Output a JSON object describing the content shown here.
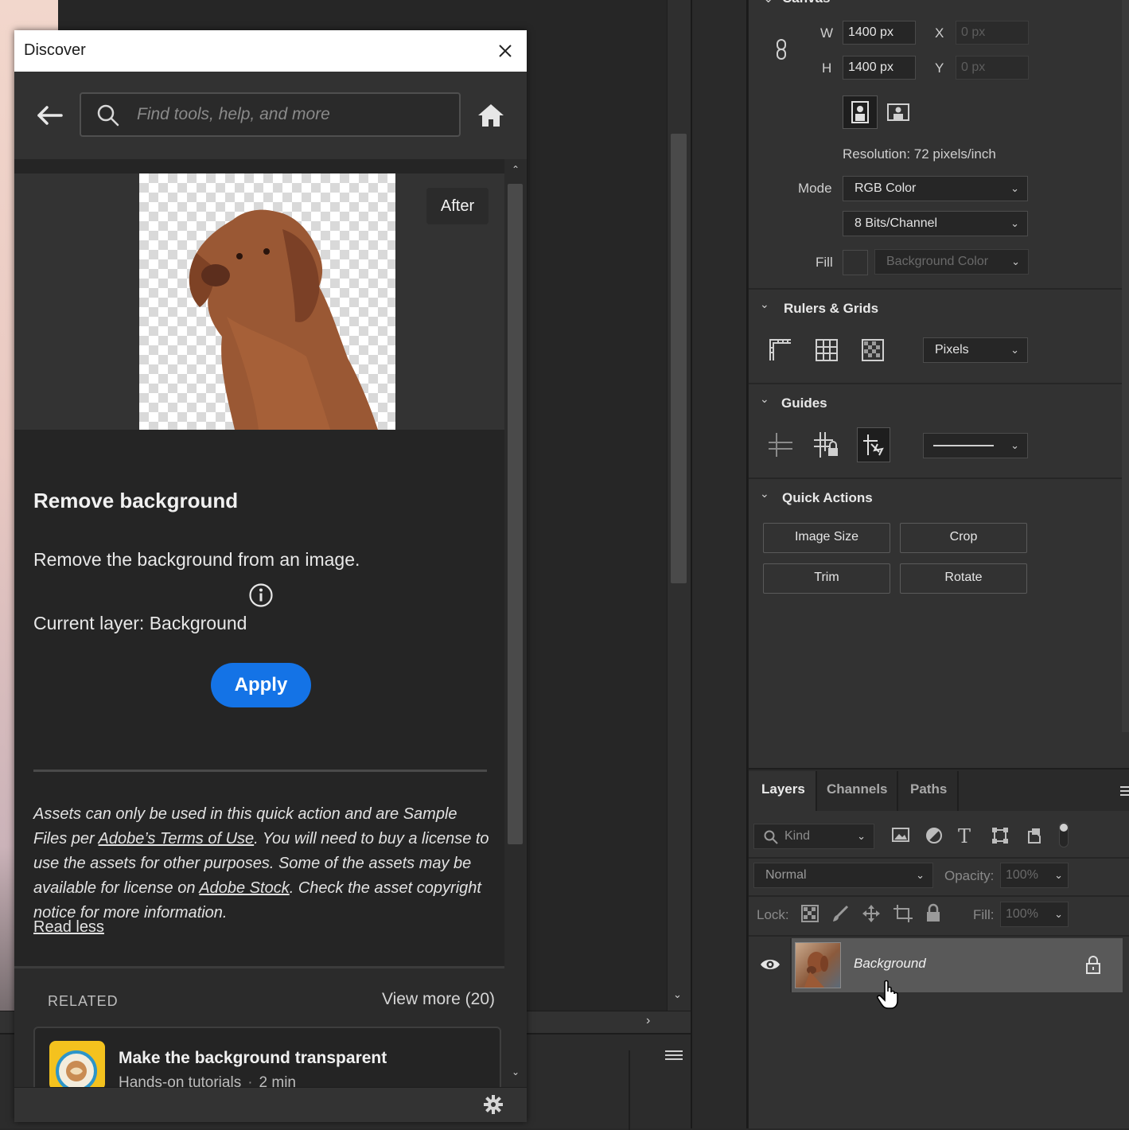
{
  "discover": {
    "title": "Discover",
    "search_placeholder": "Find tools, help, and more",
    "preview_badge": "After",
    "feature_title": "Remove background",
    "feature_desc": "Remove the background from an image.",
    "current_layer": "Current layer: Background",
    "apply_label": "Apply",
    "legal_1": "Assets can only be used in this quick action and are Sample Files per ",
    "legal_link_1": "Adobe’s Terms of Use",
    "legal_2": ". You will need to buy a license to use the assets for other purposes. Some of the assets may be available for license on ",
    "legal_link_2": "Adobe Stock",
    "legal_3": ". Check the asset copyright notice for more information.",
    "read_less": "Read less",
    "related_label": "RELATED",
    "view_more": "View more (20)",
    "related_item": {
      "title": "Make the background transparent",
      "meta": "Hands-on tutorials",
      "duration": "2 min"
    }
  },
  "properties": {
    "canvas_title": "Canvas",
    "w_label": "W",
    "w_value": "1400 px",
    "h_label": "H",
    "h_value": "1400 px",
    "x_label": "X",
    "x_placeholder": "0 px",
    "y_label": "Y",
    "y_placeholder": "0 px",
    "resolution": "Resolution: 72 pixels/inch",
    "mode_label": "Mode",
    "mode_value": "RGB Color",
    "bits_value": "8 Bits/Channel",
    "fill_label": "Fill",
    "fill_value": "Background Color",
    "rulers_title": "Rulers & Grids",
    "units_value": "Pixels",
    "guides_title": "Guides",
    "quick_title": "Quick Actions",
    "quick_buttons": [
      "Image Size",
      "Crop",
      "Trim",
      "Rotate"
    ]
  },
  "layers_panel": {
    "tabs": [
      "Layers",
      "Channels",
      "Paths"
    ],
    "filter_kind": "Kind",
    "blend_mode": "Normal",
    "opacity_label": "Opacity:",
    "opacity_value": "100%",
    "lock_label": "Lock:",
    "fill_label": "Fill:",
    "fill_value": "100%",
    "layer_name": "Background"
  },
  "colors": {
    "accent_blue": "#1473e6",
    "panel": "#323232",
    "dialog": "#252525"
  }
}
